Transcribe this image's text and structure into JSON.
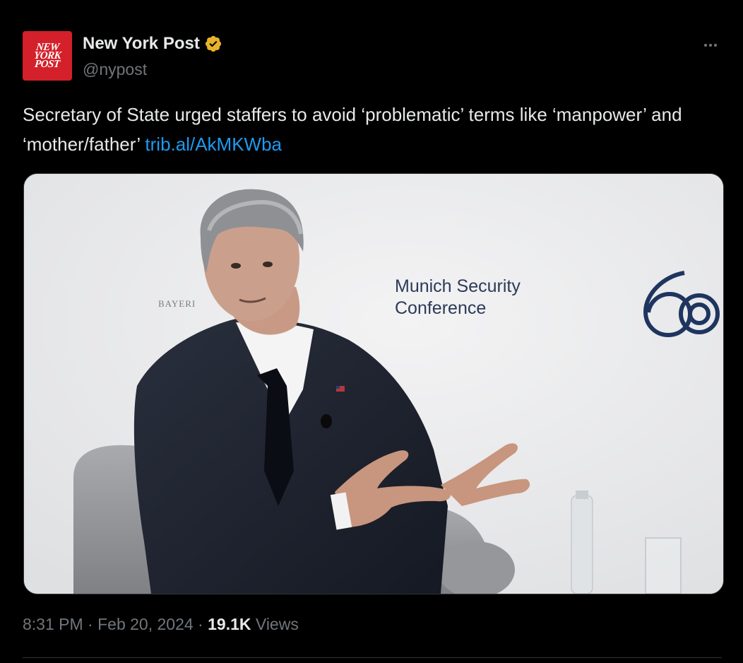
{
  "tweet": {
    "author": {
      "name": "New York Post",
      "handle": "@nypost",
      "avatar_lines": [
        "NEW",
        "YORK",
        "POST"
      ],
      "verified": true,
      "verified_color": "#e8b32a"
    },
    "text": "Secretary of State urged staffers to avoid ‘problematic’ terms like ‘manpower’ and ‘mother/father’ ",
    "link": "trib.al/AkMKWba",
    "more_icon": "more-dots-icon",
    "media": {
      "backdrop_text_1": "Munich Security",
      "backdrop_text_2": "Conference",
      "sponsor_text": "BAYERI",
      "logo_text": "60"
    },
    "meta": {
      "time": "8:31 PM",
      "separator": "·",
      "date": "Feb 20, 2024",
      "views_count": "19.1K",
      "views_label": "Views"
    },
    "colors": {
      "background": "#000000",
      "text": "#e7e9ea",
      "secondary": "#71767b",
      "link": "#1d9bf0",
      "avatar_bg": "#d3202a"
    }
  }
}
